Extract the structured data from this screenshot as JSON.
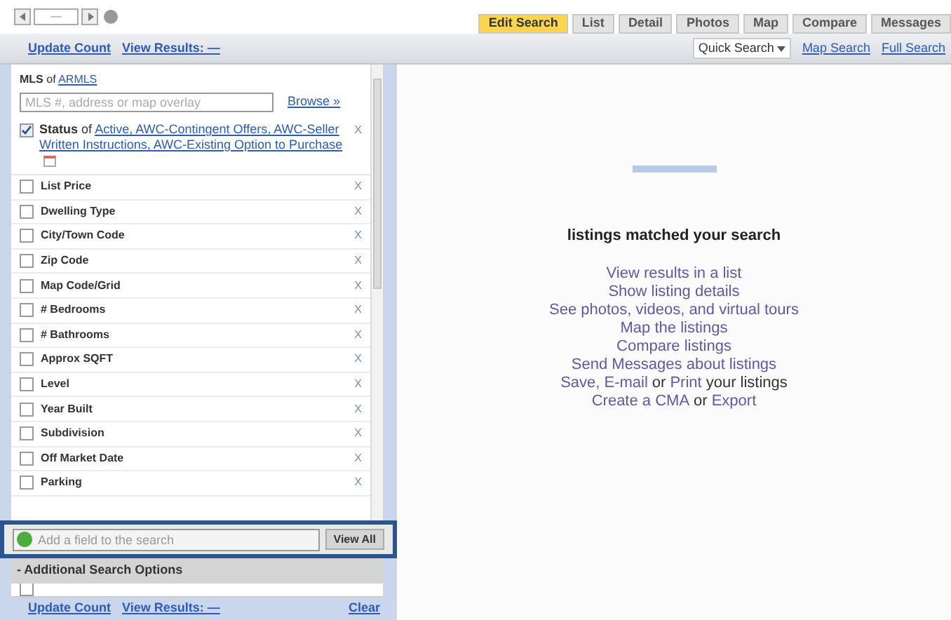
{
  "nav": {
    "page_field": "—"
  },
  "tabs": [
    {
      "label": "Edit Search",
      "selected": true
    },
    {
      "label": "List",
      "selected": false
    },
    {
      "label": "Detail",
      "selected": false
    },
    {
      "label": "Photos",
      "selected": false
    },
    {
      "label": "Map",
      "selected": false
    },
    {
      "label": "Compare",
      "selected": false
    },
    {
      "label": "Messages",
      "selected": false
    }
  ],
  "top_actions": {
    "update_count": "Update Count",
    "view_results": "View Results: —"
  },
  "search_links": {
    "quick_search": "Quick Search",
    "map_search": "Map Search",
    "full_search": "Full Search"
  },
  "mls": {
    "label": "MLS",
    "of": "of",
    "source": "ARMLS",
    "placeholder": "MLS #, address or map overlay",
    "browse": "Browse »"
  },
  "status": {
    "label": "Status",
    "of": "of",
    "value": "Active, AWC-Contingent Offers, AWC-Seller Written Instructions, AWC-Existing Option to Purchase",
    "checked": true,
    "remove": "X"
  },
  "fields": [
    {
      "label": "List Price",
      "checked": false,
      "remove": "X"
    },
    {
      "label": "Dwelling Type",
      "checked": false,
      "remove": "X"
    },
    {
      "label": "City/Town Code",
      "checked": false,
      "remove": "X"
    },
    {
      "label": "Zip Code",
      "checked": false,
      "remove": "X"
    },
    {
      "label": "Map Code/Grid",
      "checked": false,
      "remove": "X"
    },
    {
      "label": "# Bedrooms",
      "checked": false,
      "remove": "X"
    },
    {
      "label": "# Bathrooms",
      "checked": false,
      "remove": "X"
    },
    {
      "label": "Approx SQFT",
      "checked": false,
      "remove": "X"
    },
    {
      "label": "Level",
      "checked": false,
      "remove": "X"
    },
    {
      "label": "Year Built",
      "checked": false,
      "remove": "X"
    },
    {
      "label": "Subdivision",
      "checked": false,
      "remove": "X"
    },
    {
      "label": "Off Market Date",
      "checked": false,
      "remove": "X"
    },
    {
      "label": "Parking",
      "checked": false,
      "remove": "X"
    }
  ],
  "add_field": {
    "placeholder": "Add a field to the search",
    "view_all": "View All"
  },
  "additional_options": {
    "title": "- Additional Search Options",
    "first_checked": false
  },
  "bottom_actions": {
    "update_count": "Update Count",
    "view_results": "View Results: —",
    "clear": "Clear"
  },
  "results": {
    "heading": "listings matched your search",
    "lines": [
      [
        {
          "kind": "link",
          "text": "View results in a list"
        }
      ],
      [
        {
          "kind": "link",
          "text": "Show listing details"
        }
      ],
      [
        {
          "kind": "link",
          "text": "See photos, videos, and virtual tours"
        }
      ],
      [
        {
          "kind": "link",
          "text": "Map the listings"
        }
      ],
      [
        {
          "kind": "link",
          "text": "Compare listings"
        }
      ],
      [
        {
          "kind": "link",
          "text": "Send Messages about listings"
        }
      ],
      [
        {
          "kind": "link",
          "text": "Save, E-mail"
        },
        {
          "kind": "plain",
          "text": "or"
        },
        {
          "kind": "link",
          "text": "Print"
        },
        {
          "kind": "plain",
          "text": "your listings"
        }
      ],
      [
        {
          "kind": "link",
          "text": "Create a CMA"
        },
        {
          "kind": "plain",
          "text": "or"
        },
        {
          "kind": "link",
          "text": "Export"
        }
      ]
    ]
  }
}
